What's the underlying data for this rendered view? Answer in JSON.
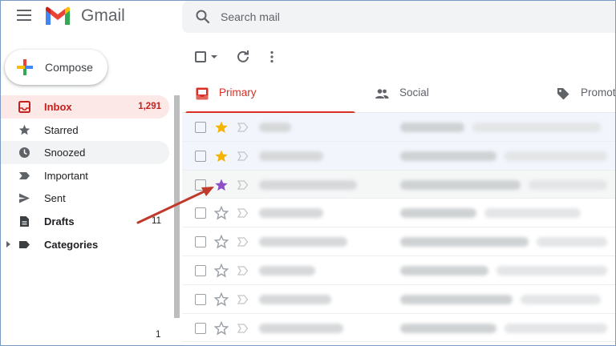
{
  "header": {
    "app_name": "Gmail",
    "search_placeholder": "Search mail"
  },
  "compose": {
    "label": "Compose"
  },
  "sidebar": {
    "items": [
      {
        "label": "Inbox",
        "count": "1,291",
        "icon": "inbox-icon"
      },
      {
        "label": "Starred",
        "count": "",
        "icon": "star-icon"
      },
      {
        "label": "Snoozed",
        "count": "",
        "icon": "clock-icon"
      },
      {
        "label": "Important",
        "count": "",
        "icon": "important-icon"
      },
      {
        "label": "Sent",
        "count": "",
        "icon": "send-icon"
      },
      {
        "label": "Drafts",
        "count": "11",
        "icon": "draft-icon"
      },
      {
        "label": "Categories",
        "count": "",
        "icon": "label-icon"
      }
    ],
    "bottom_count": "1"
  },
  "tabs": [
    {
      "label": "Primary",
      "icon": "inbox-icon"
    },
    {
      "label": "Social",
      "icon": "people-icon"
    },
    {
      "label": "Promoti",
      "icon": "tag-icon"
    }
  ],
  "rows": [
    {
      "star": "yellow",
      "tail": ""
    },
    {
      "star": "yellow",
      "tail": ""
    },
    {
      "star": "purple",
      "tail": ""
    },
    {
      "star": "empty",
      "tail": ""
    },
    {
      "star": "empty",
      "tail": ""
    },
    {
      "star": "empty",
      "tail": ""
    },
    {
      "star": "empty",
      "tail": ""
    },
    {
      "star": "empty",
      "tail": ""
    }
  ],
  "colors": {
    "accent_red": "#d93025",
    "inbox_bg": "#fce8e6",
    "star_yellow": "#f4b400",
    "star_purple": "#8e4ec6",
    "annotation_arrow": "#c0392b"
  }
}
